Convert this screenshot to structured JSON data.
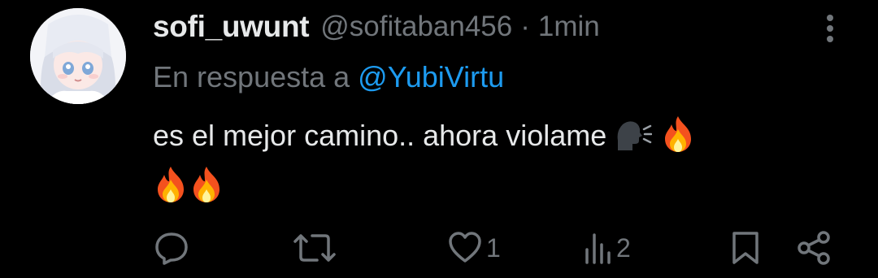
{
  "tweet": {
    "display_name": "sofi_uwunt",
    "handle": "@sofitaban456",
    "separator": "·",
    "time": "1min",
    "reply_prefix": "En respuesta a",
    "reply_to": "@YubiVirtu",
    "text": "es el mejor camino.. ahora violame",
    "emojis": [
      "speaking-head",
      "fire",
      "fire",
      "fire"
    ]
  },
  "actions": {
    "reply_count": "",
    "retweet_count": "",
    "like_count": "1",
    "views_count": "2"
  },
  "colors": {
    "background": "#000000",
    "text": "#e7e9ea",
    "muted": "#71767b",
    "accent": "#1d9bf0"
  }
}
